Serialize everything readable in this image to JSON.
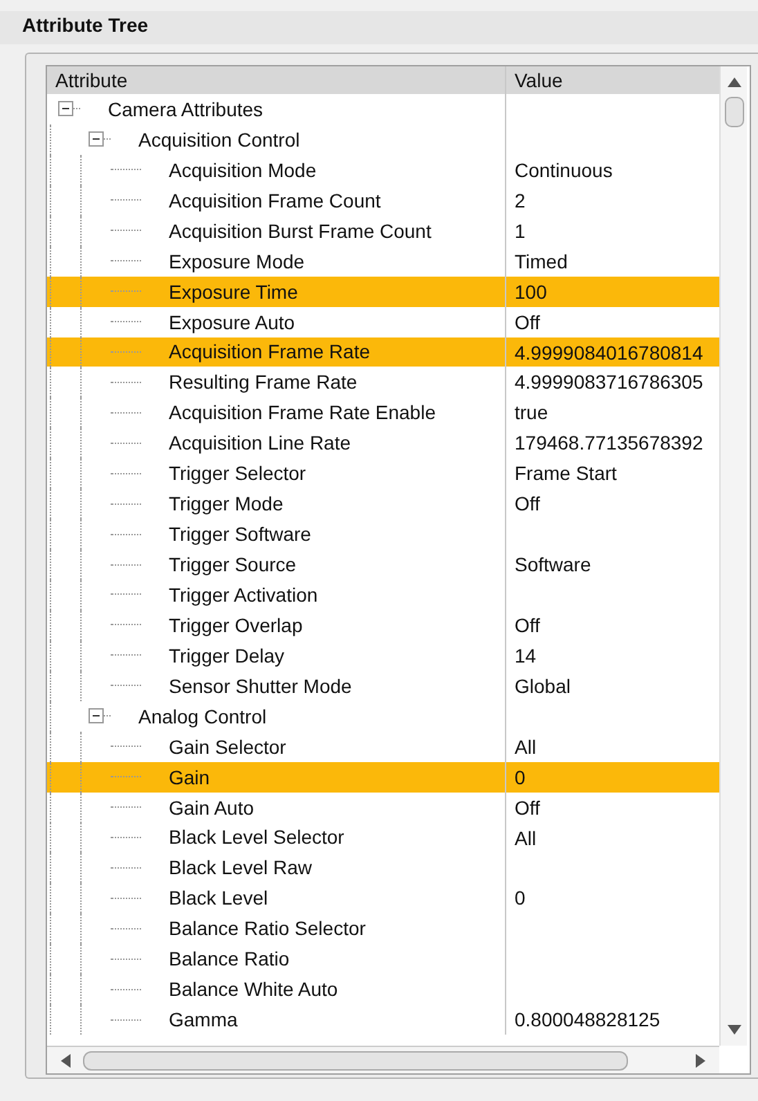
{
  "panel": {
    "title": "Attribute Tree"
  },
  "tree": {
    "columns": [
      "Attribute",
      "Value"
    ],
    "nodes": [
      {
        "name": "Camera Attributes",
        "expanded": true,
        "children": [
          {
            "name": "Acquisition Control",
            "expanded": true,
            "children": [
              {
                "name": "Acquisition Mode",
                "value": "Continuous",
                "highlighted": false
              },
              {
                "name": "Acquisition Frame Count",
                "value": "2",
                "highlighted": false
              },
              {
                "name": "Acquisition Burst Frame Count",
                "value": "1",
                "highlighted": false
              },
              {
                "name": "Exposure Mode",
                "value": "Timed",
                "highlighted": false
              },
              {
                "name": "Exposure Time",
                "value": "100",
                "highlighted": true
              },
              {
                "name": "Exposure Auto",
                "value": "Off",
                "highlighted": false
              },
              {
                "name": "Acquisition Frame Rate",
                "value": "4.9999084016780814",
                "highlighted": true
              },
              {
                "name": "Resulting Frame Rate",
                "value": "4.9999083716786305",
                "highlighted": false
              },
              {
                "name": "Acquisition Frame Rate Enable",
                "value": "true",
                "highlighted": false
              },
              {
                "name": "Acquisition Line Rate",
                "value": "179468.77135678392",
                "highlighted": false
              },
              {
                "name": "Trigger Selector",
                "value": "Frame Start",
                "highlighted": false
              },
              {
                "name": "Trigger Mode",
                "value": "Off",
                "highlighted": false
              },
              {
                "name": "Trigger Software",
                "highlighted": false
              },
              {
                "name": "Trigger Source",
                "value": "Software",
                "highlighted": false
              },
              {
                "name": "Trigger Activation",
                "highlighted": false
              },
              {
                "name": "Trigger Overlap",
                "value": "Off",
                "highlighted": false
              },
              {
                "name": "Trigger Delay",
                "value": "14",
                "highlighted": false
              },
              {
                "name": "Sensor Shutter Mode",
                "value": "Global",
                "highlighted": false
              }
            ]
          },
          {
            "name": "Analog Control",
            "expanded": true,
            "children": [
              {
                "name": "Gain Selector",
                "value": "All",
                "highlighted": false
              },
              {
                "name": "Gain",
                "value": "0",
                "highlighted": true
              },
              {
                "name": "Gain Auto",
                "value": "Off",
                "highlighted": false
              },
              {
                "name": "Black Level Selector",
                "value": "All",
                "highlighted": false
              },
              {
                "name": "Black Level Raw",
                "highlighted": false
              },
              {
                "name": "Black Level",
                "value": "0",
                "highlighted": false
              },
              {
                "name": "Balance Ratio Selector",
                "highlighted": false
              },
              {
                "name": "Balance Ratio",
                "highlighted": false
              },
              {
                "name": "Balance White Auto",
                "highlighted": false
              },
              {
                "name": "Gamma",
                "value": "0.800048828125",
                "highlighted": false
              }
            ]
          }
        ]
      }
    ]
  }
}
